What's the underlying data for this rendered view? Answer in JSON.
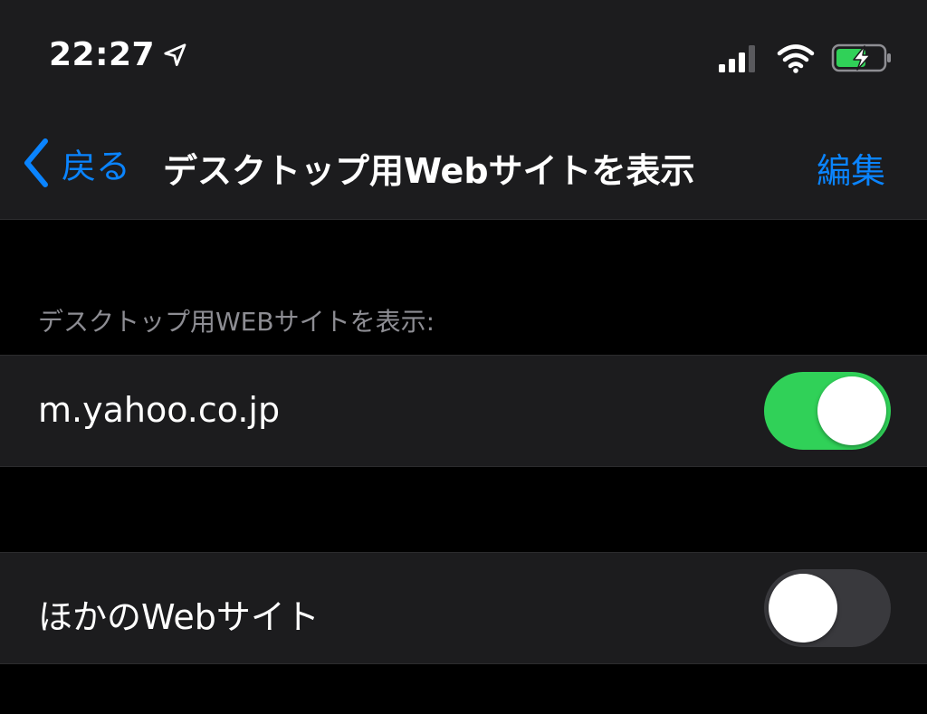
{
  "status_bar": {
    "time": "22:27",
    "icons": [
      "location-arrow-icon",
      "signal-icon",
      "wifi-icon",
      "battery-charging-icon"
    ]
  },
  "nav": {
    "back_label": "戻る",
    "title": "デスクトップ用Webサイトを表示",
    "edit_label": "編集"
  },
  "section": {
    "header": "デスクトップ用WEBサイトを表示:"
  },
  "rows": [
    {
      "label": "m.yahoo.co.jp",
      "toggle": "on"
    },
    {
      "label": "ほかのWebサイト",
      "toggle": "off"
    }
  ],
  "colors": {
    "accent": "#0a84ff",
    "toggle_on": "#30d158",
    "toggle_off": "#39393d",
    "battery": "#30d158"
  }
}
